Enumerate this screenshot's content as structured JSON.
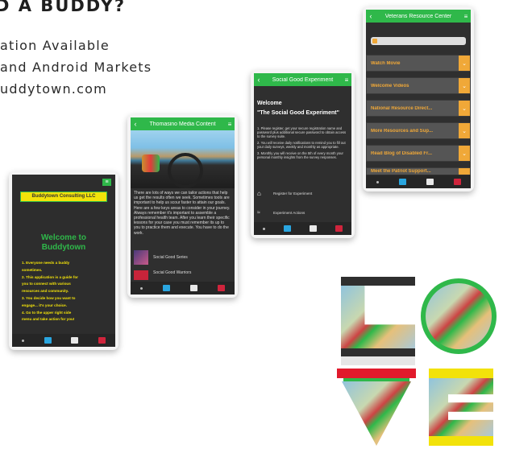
{
  "promo": {
    "headline": "D A BUDDY?",
    "lines": [
      "ation Available",
      "and Android Markets",
      "uddytown.com"
    ]
  },
  "phone1": {
    "header_button": "Buddytown Consulting LLC",
    "welcome": "Welcome to Buddytown",
    "lines": [
      "1. Everyone needs a buddy",
      "sometimes.",
      "2. This application is a guide for",
      "you to connect with various",
      "resources and community.",
      "3. You decide how you want to",
      "engage... it's your choice.",
      "4. Go to the upper right side",
      "menu and take action for you!"
    ]
  },
  "phone2": {
    "title": "Thomasino Media Content",
    "body": "There are lots of ways we can tailor actions that help us get the results often we seek. Sometimes tools are important to help us scour faster to attain our goals. Here are a few keys areas to consider in your journey. Always remember it's important to assemble a professional health team. After you learn their specific lessons for your case you must remember its up to you to practice them and execute. You have to do the work.",
    "items": [
      "Social Good Series",
      "Social Good Warriors"
    ]
  },
  "phone3": {
    "title": "Social Good Experiment",
    "heading": "Welcome",
    "subheading": "\"The Social Good Experiment\"",
    "paragraphs": [
      "1. Please register, get your secure registration name and password plus additional secure password to obtain access to the survey suite.",
      "2. You will receive daily notifications to remind you to fill out your daily surveys, weekly and monthly as appropriate.",
      "3. Monthly you will receive on the 5th of every month your personal monthly insights from the survey responses."
    ],
    "actions": [
      "Register for Experiment",
      "Experiment Actions"
    ]
  },
  "phone4": {
    "title": "Veterans Resource Center",
    "rows": [
      "Watch Movie",
      "Welcome Videos",
      "National Resource Direct...",
      "More Resources and Sup...",
      "Read Blog of Disabled Fr...",
      "Meet the Patriot Support..."
    ]
  },
  "colors": {
    "green": "#2fb84a",
    "gold": "#f0a838",
    "red": "#d0243c",
    "yellow": "#f2e20a",
    "blue": "#2aa6e0"
  }
}
